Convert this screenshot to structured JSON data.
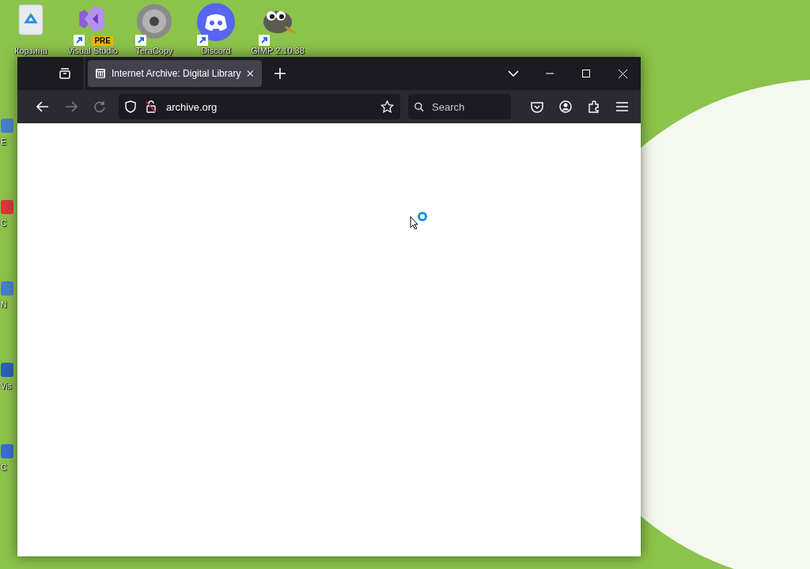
{
  "desktop": {
    "icons": [
      {
        "kind": "bin",
        "label": "Корзина",
        "shortcut": false
      },
      {
        "kind": "ide",
        "label": "Visual Studio",
        "shortcut": true,
        "badge": "PRE"
      },
      {
        "kind": "disc",
        "label": "TeraCopy",
        "shortcut": true
      },
      {
        "kind": "chat",
        "label": "Discord",
        "shortcut": true
      },
      {
        "kind": "gimp",
        "label": "GIMP 2.10.38",
        "shortcut": true
      }
    ],
    "side_icons": [
      {
        "label": "E",
        "color": "#4a7fd0"
      },
      {
        "label": "C",
        "color": "#d83a3a"
      },
      {
        "label": "N",
        "color": "#4a7fd0"
      },
      {
        "label": "Vis",
        "color": "#2b63b8"
      },
      {
        "label": "C",
        "color": "#3d6fd1"
      }
    ]
  },
  "browser": {
    "tabs": [
      {
        "title": "Internet Archive: Digital Library",
        "selected": true
      }
    ],
    "url": "archive.org",
    "search": {
      "placeholder": "Search"
    },
    "loading": true
  }
}
